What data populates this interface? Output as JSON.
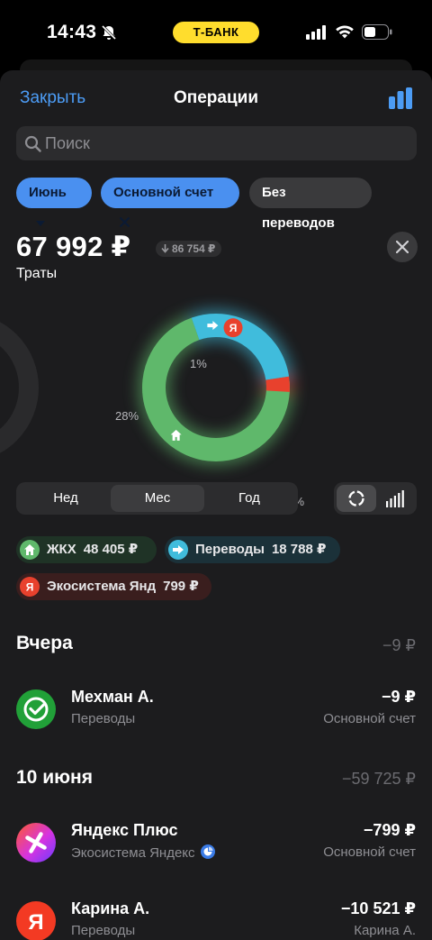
{
  "status_bar": {
    "time": "14:43",
    "carrier_pill": "Т-БАНК"
  },
  "nav": {
    "close_label": "Закрыть",
    "title": "Операции"
  },
  "search": {
    "placeholder": "Поиск"
  },
  "filters": {
    "month": "Июнь",
    "account": "Основной счет",
    "transfers": "Без переводов"
  },
  "summary": {
    "amount": "67 992 ₽",
    "previous": "86 754 ₽",
    "label": "Траты"
  },
  "chart_data": {
    "type": "pie",
    "categories": [
      "ЖКХ",
      "Переводы",
      "Экосистема Яндекс"
    ],
    "values": [
      71,
      28,
      1
    ],
    "percent_labels": [
      "71%",
      "28%",
      "1%"
    ],
    "colors": [
      "#5fb86b",
      "#40bcdc",
      "#e8412d"
    ]
  },
  "period_tabs": [
    "Нед",
    "Мес",
    "Год"
  ],
  "active_period": "Мес",
  "categories": [
    {
      "name": "ЖКХ",
      "value": "48 405 ₽",
      "icon": "house-icon",
      "color": "#5fb86b"
    },
    {
      "name": "Переводы",
      "value": "18 788 ₽",
      "icon": "arrow-right-icon",
      "color": "#40bcdc"
    },
    {
      "name": "Экосистема Янд",
      "value": "799 ₽",
      "icon": "yandex-icon",
      "color": "#e8412d"
    }
  ],
  "sections": [
    {
      "title": "Вчера",
      "total": "−9 ₽"
    },
    {
      "title": "10 июня",
      "total": "−59 725 ₽"
    }
  ],
  "operations": [
    {
      "name": "Мехман А.",
      "category": "Переводы",
      "amount": "−9 ₽",
      "account": "Основной счет",
      "icon": "sber-check-icon"
    },
    {
      "name": "Яндекс Плюс",
      "category": "Экосистема Яндекс",
      "amount": "−799 ₽",
      "account": "Основной счет",
      "icon": "yandex-plus-icon"
    },
    {
      "name": "Карина А.",
      "category": "Переводы",
      "amount": "−10 521 ₽",
      "account": "Карина А.",
      "icon": "yandex-icon"
    }
  ]
}
